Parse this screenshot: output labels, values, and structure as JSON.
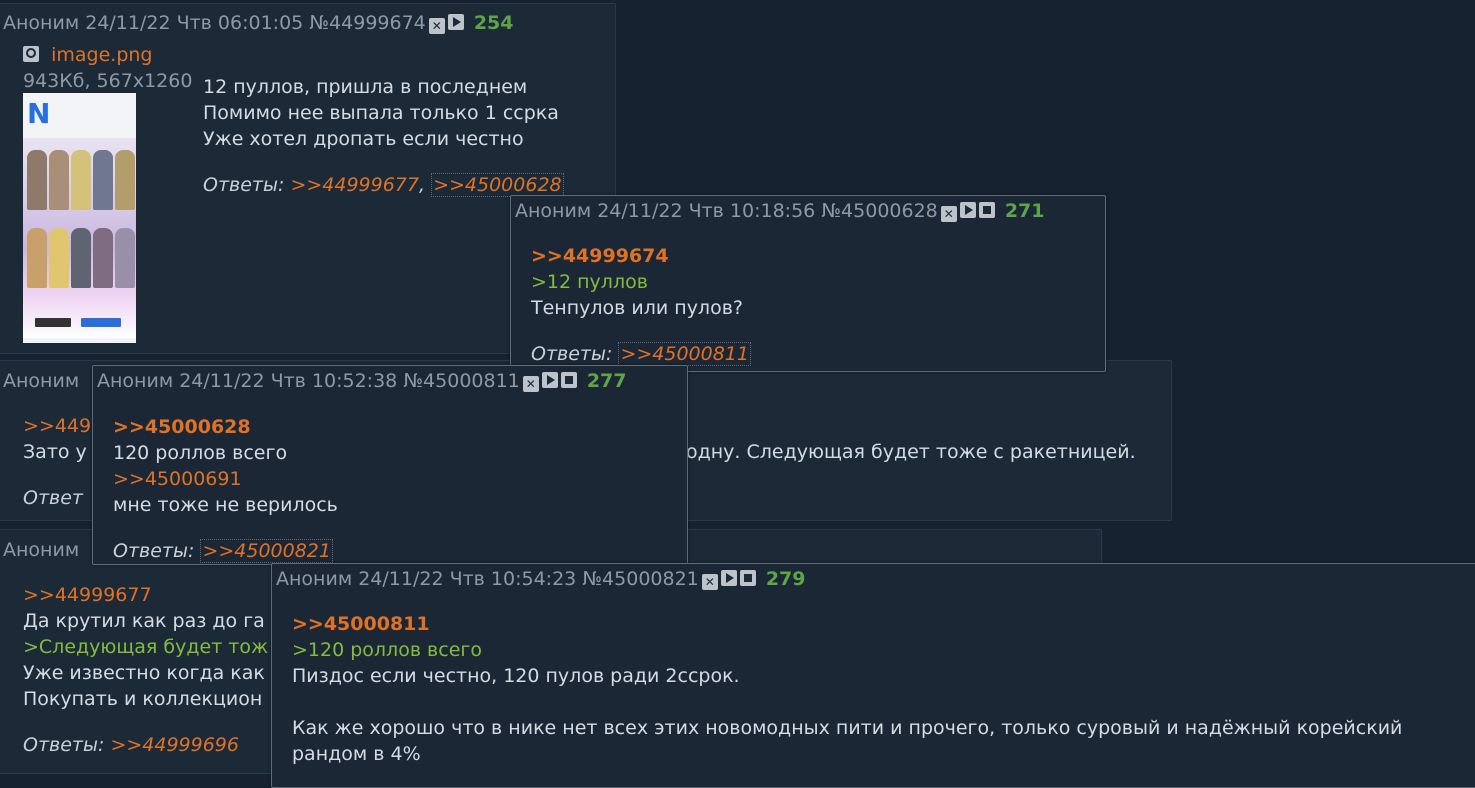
{
  "posts": [
    {
      "author": "Аноним",
      "date": "24/11/22 Чтв 06:01:05",
      "number": "№44999674",
      "index": "254",
      "file": {
        "name": "image.png",
        "meta": "943Кб, 567x1260"
      },
      "lines": [
        "12 пуллов, пришла в последнем",
        "Помимо нее выпала только 1 ссрка",
        "Уже хотел дропать если честно"
      ],
      "answers_label": "Ответы:",
      "answers": [
        ">>44999677",
        ">>45000628"
      ]
    },
    {
      "author": "Аноним",
      "date": "24/11/22 Чтв 10:18:56",
      "number": "№45000628",
      "index": "271",
      "reply_link": ">>44999674",
      "quote": ">12 пуллов",
      "text": "Тенпулов или пулов?",
      "answers_label": "Ответы:",
      "answers": [
        ">>45000811"
      ]
    },
    {
      "author_partial": "Аноним",
      "link_partial": ">>449",
      "text_left": "Зато у",
      "text_right": "одну. Следующая будет тоже с ракетницей.",
      "answers_label_partial": "Ответ"
    },
    {
      "author": "Аноним",
      "date": "24/11/22 Чтв 10:52:38",
      "number": "№45000811",
      "index": "277",
      "reply_link": ">>45000628",
      "line1": "120 роллов всего",
      "link2": ">>45000691",
      "line2": "мне тоже не верилось",
      "answers_label": "Ответы:",
      "answers": [
        ">>45000821"
      ]
    },
    {
      "author_partial": "Аноним",
      "reply_link": ">>44999677",
      "line1": "Да крутил как раз до га",
      "quote": ">Следующая будет тож",
      "line2": "Уже известно когда как",
      "line3": "Покупать и коллекцион",
      "answers_label": "Ответы:",
      "answers": [
        ">>44999696"
      ]
    },
    {
      "author": "Аноним",
      "date": "24/11/22 Чтв 10:54:23",
      "number": "№45000821",
      "index": "279",
      "reply_link": ">>45000811",
      "quote": ">120 роллов всего",
      "line1": "Пиздос если честно, 120 пулов ради 2ссрок.",
      "line2": "Как же хорошо что в нике нет всех этих новомодных пити и прочего, только суровый и надёжный корейский",
      "line3": "рандом в 4%"
    }
  ],
  "colors": {
    "link": "#e07227",
    "quote": "#86bb3f",
    "post_num": "#5ea548",
    "bg": "#172230",
    "post_bg": "#1c2a38"
  },
  "icons": [
    "magnifier-icon",
    "close-icon",
    "play-icon",
    "stop-icon"
  ]
}
